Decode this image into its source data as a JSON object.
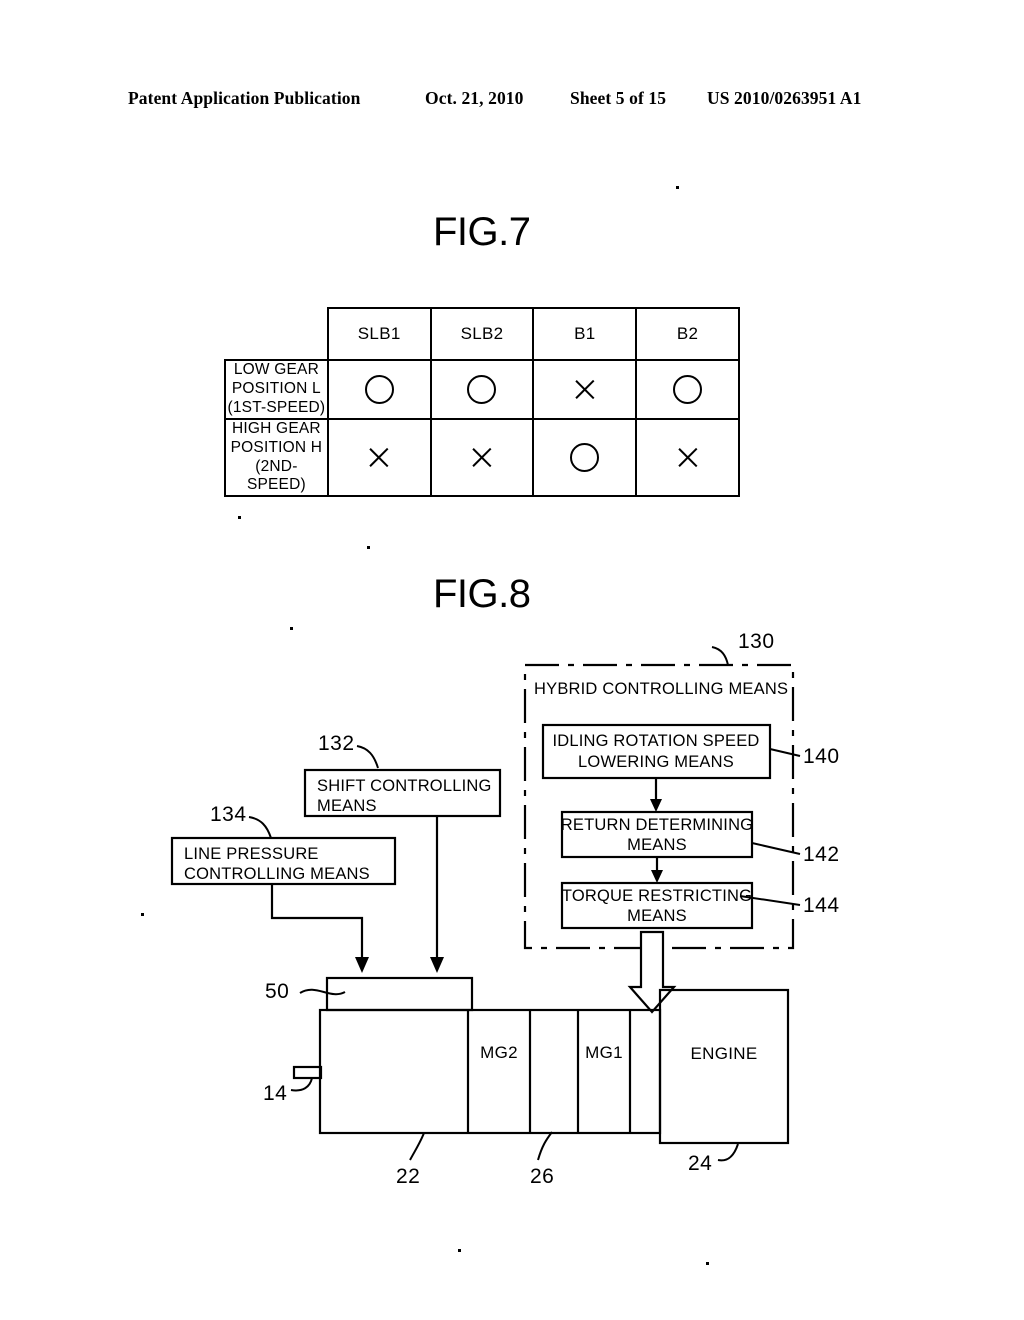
{
  "header": {
    "publication": "Patent Application Publication",
    "date": "Oct. 21, 2010",
    "sheet": "Sheet 5 of 15",
    "number": "US 2010/0263951 A1"
  },
  "fig7": {
    "title": "FIG.7",
    "table": {
      "corner": "",
      "columns": [
        "SLB1",
        "SLB2",
        "B1",
        "B2"
      ],
      "rows": [
        {
          "label_line1": "LOW GEAR POSITION L",
          "label_line2": "(1ST-SPEED)",
          "marks": [
            "circle",
            "circle",
            "cross",
            "circle"
          ]
        },
        {
          "label_line1": "HIGH GEAR POSITION H",
          "label_line2": "(2ND-SPEED)",
          "marks": [
            "cross",
            "cross",
            "circle",
            "cross"
          ]
        }
      ]
    }
  },
  "fig8": {
    "title": "FIG.8",
    "hybrid_box": {
      "ref": "130",
      "title": "HYBRID CONTROLLING MEANS",
      "blocks": [
        {
          "ref": "140",
          "line1": "IDLING ROTATION SPEED",
          "line2": "LOWERING MEANS"
        },
        {
          "ref": "142",
          "line1": "RETURN DETERMINING",
          "line2": "MEANS"
        },
        {
          "ref": "144",
          "line1": "TORQUE RESTRICTING",
          "line2": "MEANS"
        }
      ]
    },
    "left_blocks": [
      {
        "ref": "132",
        "line1": "SHIFT CONTROLLING",
        "line2": "MEANS"
      },
      {
        "ref": "134",
        "line1": "LINE PRESSURE",
        "line2": "CONTROLLING MEANS"
      }
    ],
    "powertrain": {
      "hydraulic_unit_ref": "50",
      "output_shaft_ref": "14",
      "transmission_ref": "22",
      "planetary_ref": "26",
      "engine_ref": "24",
      "mg2_label": "MG2",
      "mg1_label": "MG1",
      "engine_label": "ENGINE"
    }
  }
}
